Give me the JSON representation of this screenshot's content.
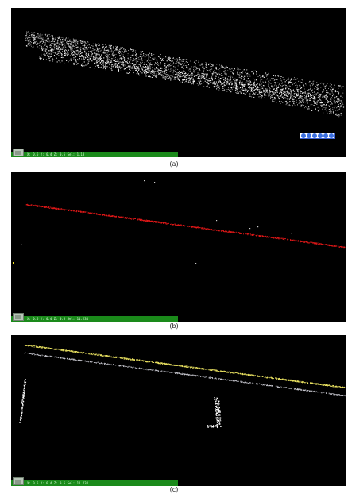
{
  "panels": [
    {
      "id": "a",
      "caption": "(a)",
      "status_text": "X: 0.5 Y: 0.4 Z: 0.5 Sel: 1.18",
      "point_color": "#d8d8d8",
      "toolbar_icons": [
        "rotate-icon",
        "pan-icon",
        "zoom-icon",
        "fit-icon",
        "measure-icon",
        "settings-icon"
      ]
    },
    {
      "id": "b",
      "caption": "(b)",
      "status_text": "X: 0.5 Y: 0.4 Z: 0.5 Sel: 11.234",
      "point_color": "#e01818",
      "accent_color": "#f0e020"
    },
    {
      "id": "c",
      "caption": "(c)",
      "status_text": "X: 0.5 Y: 0.4 Z: 0.5 Sel: 11.234",
      "point_color": "#e8e060",
      "secondary_color": "#ffffff"
    }
  ],
  "colors": {
    "viewport_bg": "#000000",
    "statusbar_bg": "#1a8a1a",
    "toolbar_accent": "#3b6fe0"
  }
}
